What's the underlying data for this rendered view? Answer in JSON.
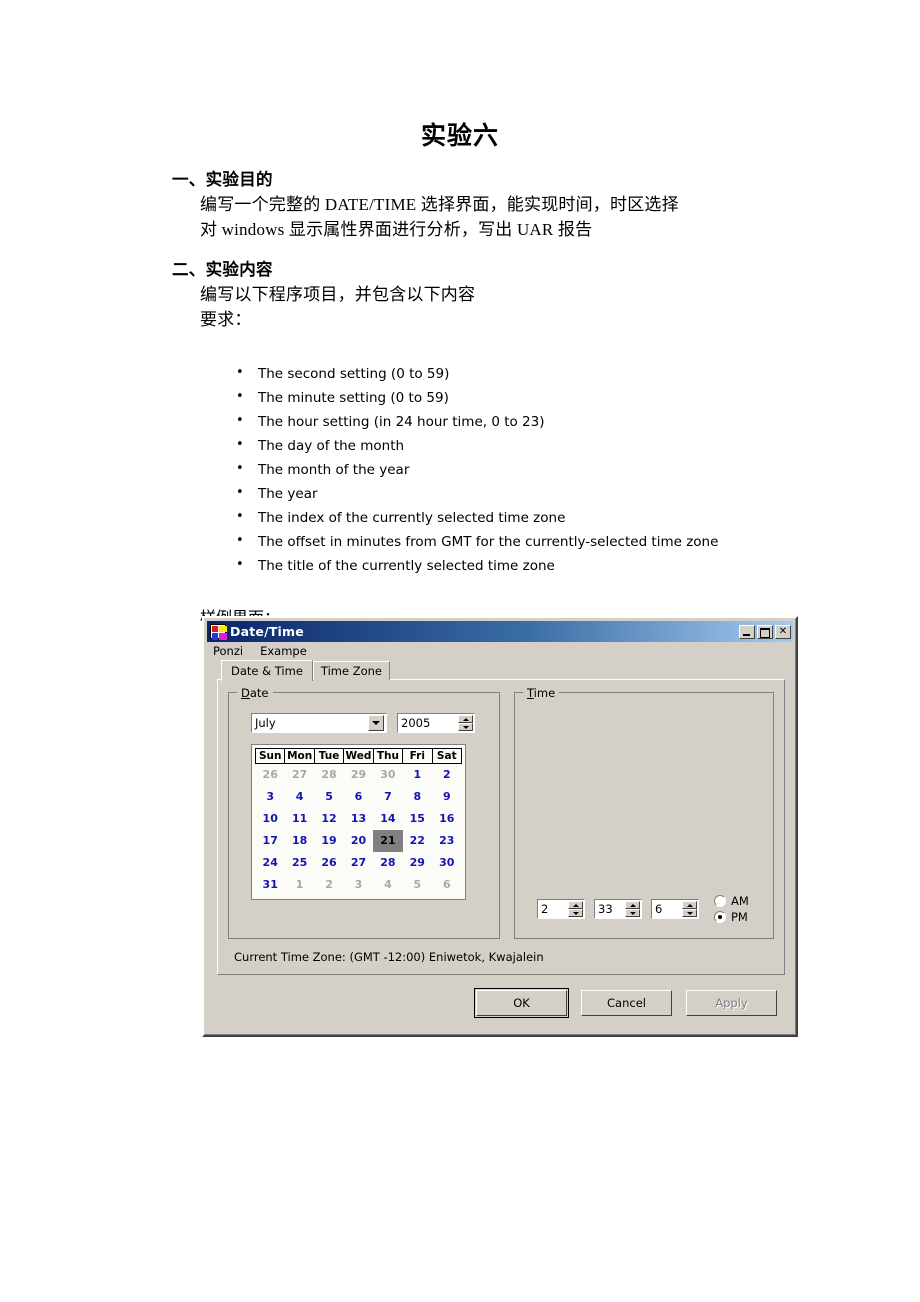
{
  "document": {
    "title": "实验六",
    "sections": [
      {
        "heading": "一、实验目的",
        "lines": [
          "编写一个完整的 DATE/TIME 选择界面，能实现时间，时区选择",
          "对 windows 显示属性界面进行分析，写出 UAR 报告"
        ]
      },
      {
        "heading": "二、实验内容",
        "lines": [
          "编写以下程序项目，并包含以下内容",
          "要求："
        ]
      }
    ],
    "bullets": [
      "The second setting (0 to 59)",
      "The minute setting (0 to 59)",
      "The hour setting (in 24 hour time, 0 to 23)",
      "The day of the month",
      "The month of the year",
      "The year",
      "The index of the currently selected time zone",
      "The offset in minutes from GMT for the currently-selected time zone",
      "The title of the currently selected time zone"
    ],
    "sample_label": "样例界面："
  },
  "dialog": {
    "title": "Date/Time",
    "window_buttons": {
      "minimize": "minimize-icon",
      "maximize": "maximize-icon",
      "close": "✕"
    },
    "menu": [
      "Ponzi",
      "Exampe"
    ],
    "tabs": [
      {
        "label": "Date & Time",
        "active": true
      },
      {
        "label": "Time Zone",
        "active": false
      }
    ],
    "date_group": {
      "title_prefix": "D",
      "title_rest": "ate",
      "month_value": "July",
      "year_value": "2005",
      "weekday_headers": [
        "Sun",
        "Mon",
        "Tue",
        "Wed",
        "Thu",
        "Fri",
        "Sat"
      ],
      "weeks": [
        [
          {
            "d": "26",
            "c": "other"
          },
          {
            "d": "27",
            "c": "other"
          },
          {
            "d": "28",
            "c": "other"
          },
          {
            "d": "29",
            "c": "other"
          },
          {
            "d": "30",
            "c": "other"
          },
          {
            "d": "1",
            "c": ""
          },
          {
            "d": "2",
            "c": ""
          }
        ],
        [
          {
            "d": "3",
            "c": ""
          },
          {
            "d": "4",
            "c": ""
          },
          {
            "d": "5",
            "c": ""
          },
          {
            "d": "6",
            "c": ""
          },
          {
            "d": "7",
            "c": ""
          },
          {
            "d": "8",
            "c": ""
          },
          {
            "d": "9",
            "c": ""
          }
        ],
        [
          {
            "d": "10",
            "c": ""
          },
          {
            "d": "11",
            "c": ""
          },
          {
            "d": "12",
            "c": ""
          },
          {
            "d": "13",
            "c": ""
          },
          {
            "d": "14",
            "c": ""
          },
          {
            "d": "15",
            "c": ""
          },
          {
            "d": "16",
            "c": ""
          }
        ],
        [
          {
            "d": "17",
            "c": ""
          },
          {
            "d": "18",
            "c": ""
          },
          {
            "d": "19",
            "c": ""
          },
          {
            "d": "20",
            "c": ""
          },
          {
            "d": "21",
            "c": "sel"
          },
          {
            "d": "22",
            "c": ""
          },
          {
            "d": "23",
            "c": ""
          }
        ],
        [
          {
            "d": "24",
            "c": ""
          },
          {
            "d": "25",
            "c": ""
          },
          {
            "d": "26",
            "c": ""
          },
          {
            "d": "27",
            "c": ""
          },
          {
            "d": "28",
            "c": ""
          },
          {
            "d": "29",
            "c": ""
          },
          {
            "d": "30",
            "c": ""
          }
        ],
        [
          {
            "d": "31",
            "c": ""
          },
          {
            "d": "1",
            "c": "other"
          },
          {
            "d": "2",
            "c": "other"
          },
          {
            "d": "3",
            "c": "other"
          },
          {
            "d": "4",
            "c": "other"
          },
          {
            "d": "5",
            "c": "other"
          },
          {
            "d": "6",
            "c": "other"
          }
        ]
      ]
    },
    "time_group": {
      "title_prefix": "T",
      "title_rest": "ime",
      "hour_value": "2",
      "minute_value": "33",
      "second_value": "6",
      "am_label": "AM",
      "pm_label": "PM",
      "selected_meridiem": "PM"
    },
    "timezone_line": "Current Time Zone: (GMT -12:00) Eniwetok, Kwajalein",
    "buttons": [
      {
        "label": "OK",
        "state": "default"
      },
      {
        "label": "Cancel",
        "state": "normal"
      },
      {
        "label": "Apply",
        "state": "disabled"
      }
    ]
  },
  "colors": {
    "titlebar_start": "#0a246a",
    "titlebar_end": "#a6caf0",
    "face": "#d4d0c8",
    "calendar_day": "#1414b4",
    "calendar_other": "#a8a8a8",
    "selection": "#808080"
  }
}
